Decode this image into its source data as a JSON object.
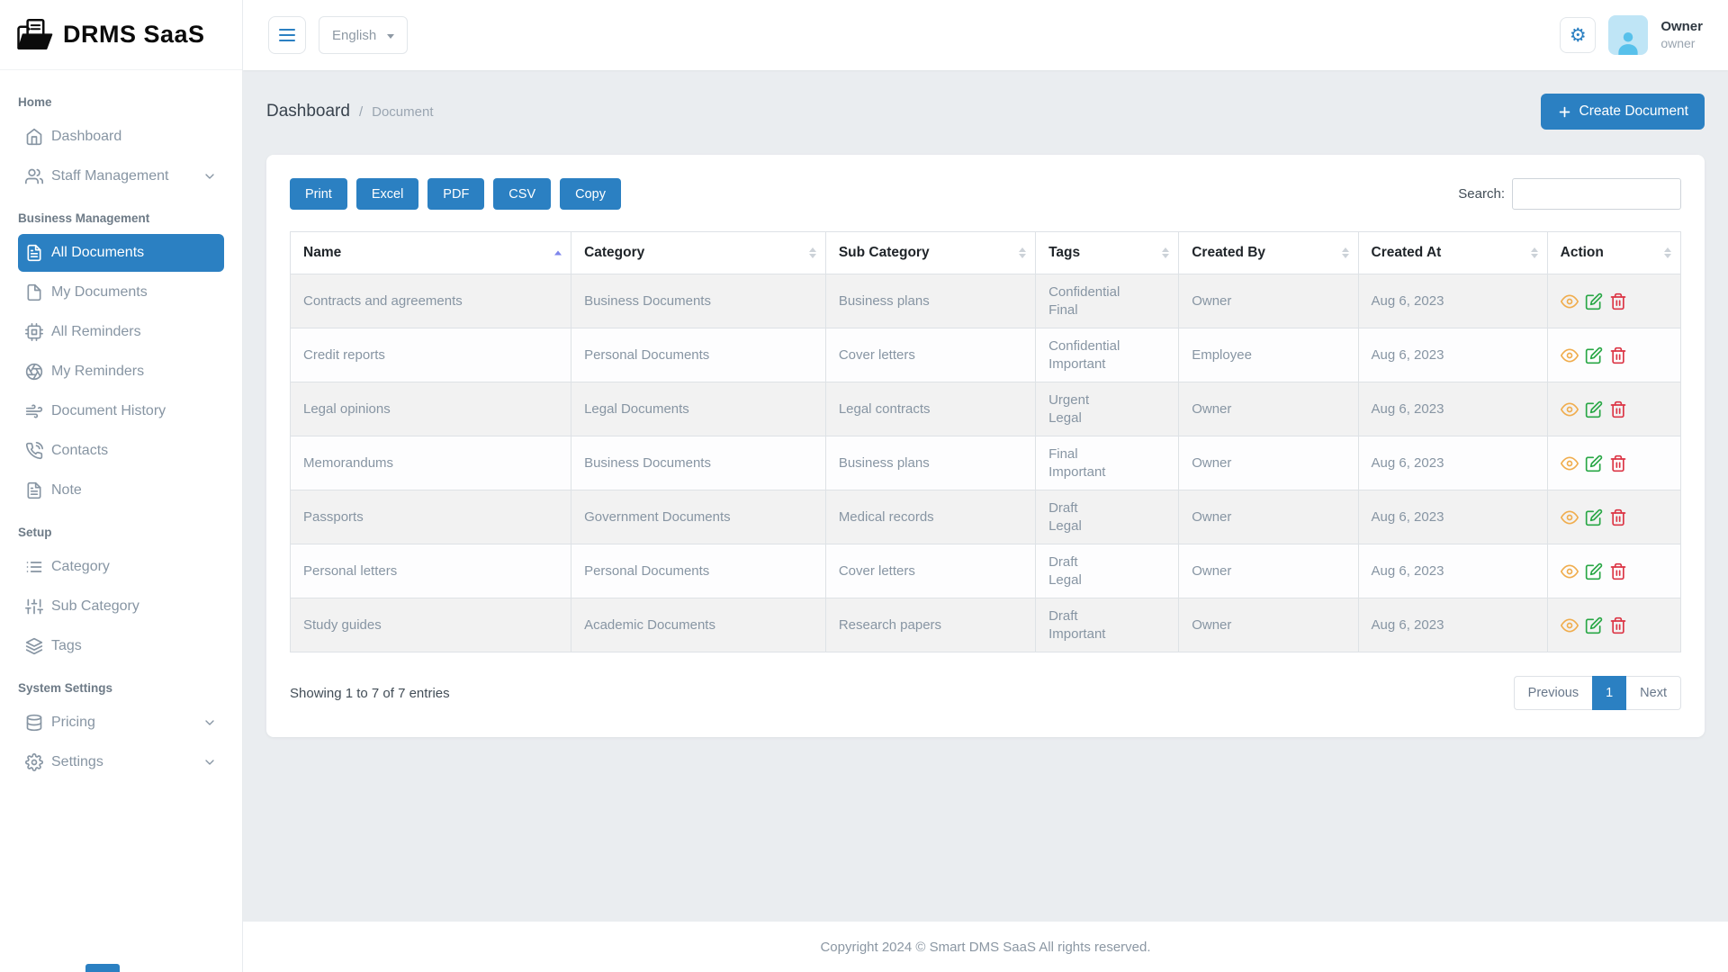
{
  "app": {
    "name": "DRMS SaaS",
    "footer": "Copyright 2024 © Smart DMS SaaS All rights reserved."
  },
  "header": {
    "language": "English",
    "user": {
      "name": "Owner",
      "role": "owner"
    }
  },
  "breadcrumb": {
    "items": [
      "Dashboard",
      "Document"
    ],
    "separator": "/"
  },
  "actions": {
    "create_label": "Create Document"
  },
  "toolbar": {
    "export_buttons": [
      "Print",
      "Excel",
      "PDF",
      "CSV",
      "Copy"
    ],
    "search_label": "Search:",
    "search_value": ""
  },
  "sidebar": {
    "sections": [
      {
        "label": "Home",
        "items": [
          {
            "label": "Dashboard",
            "icon": "home"
          },
          {
            "label": "Staff Management",
            "icon": "users",
            "expandable": true
          }
        ]
      },
      {
        "label": "Business Management",
        "items": [
          {
            "label": "All Documents",
            "icon": "file-text",
            "active": true
          },
          {
            "label": "My Documents",
            "icon": "file"
          },
          {
            "label": "All Reminders",
            "icon": "cpu"
          },
          {
            "label": "My Reminders",
            "icon": "aperture"
          },
          {
            "label": "Document History",
            "icon": "wind"
          },
          {
            "label": "Contacts",
            "icon": "phone-call"
          },
          {
            "label": "Note",
            "icon": "file-text"
          }
        ]
      },
      {
        "label": "Setup",
        "items": [
          {
            "label": "Category",
            "icon": "list"
          },
          {
            "label": "Sub Category",
            "icon": "sliders"
          },
          {
            "label": "Tags",
            "icon": "layers"
          }
        ]
      },
      {
        "label": "System Settings",
        "items": [
          {
            "label": "Pricing",
            "icon": "database",
            "expandable": true
          },
          {
            "label": "Settings",
            "icon": "settings",
            "expandable": true
          }
        ]
      }
    ]
  },
  "table": {
    "columns": [
      "Name",
      "Category",
      "Sub Category",
      "Tags",
      "Created By",
      "Created At",
      "Action"
    ],
    "sorted_column": "Name",
    "sort_direction": "asc",
    "rows": [
      {
        "name": "Contracts and agreements",
        "category": "Business Documents",
        "sub_category": "Business plans",
        "tags": [
          "Confidential",
          "Final"
        ],
        "created_by": "Owner",
        "created_at": "Aug 6, 2023"
      },
      {
        "name": "Credit reports",
        "category": "Personal Documents",
        "sub_category": "Cover letters",
        "tags": [
          "Confidential",
          "Important"
        ],
        "created_by": "Employee",
        "created_at": "Aug 6, 2023"
      },
      {
        "name": "Legal opinions",
        "category": "Legal Documents",
        "sub_category": "Legal contracts",
        "tags": [
          "Urgent",
          "Legal"
        ],
        "created_by": "Owner",
        "created_at": "Aug 6, 2023"
      },
      {
        "name": "Memorandums",
        "category": "Business Documents",
        "sub_category": "Business plans",
        "tags": [
          "Final",
          "Important"
        ],
        "created_by": "Owner",
        "created_at": "Aug 6, 2023"
      },
      {
        "name": "Passports",
        "category": "Government Documents",
        "sub_category": "Medical records",
        "tags": [
          "Draft",
          "Legal"
        ],
        "created_by": "Owner",
        "created_at": "Aug 6, 2023"
      },
      {
        "name": "Personal letters",
        "category": "Personal Documents",
        "sub_category": "Cover letters",
        "tags": [
          "Draft",
          "Legal"
        ],
        "created_by": "Owner",
        "created_at": "Aug 6, 2023"
      },
      {
        "name": "Study guides",
        "category": "Academic Documents",
        "sub_category": "Research papers",
        "tags": [
          "Draft",
          "Important"
        ],
        "created_by": "Owner",
        "created_at": "Aug 6, 2023"
      }
    ],
    "row_actions": [
      "view",
      "edit",
      "delete"
    ],
    "summary": "Showing 1 to 7 of 7 entries"
  },
  "pagination": {
    "previous": "Previous",
    "pages": [
      "1"
    ],
    "active_page": "1",
    "next": "Next"
  },
  "colors": {
    "primary": "#2b80c2",
    "view_icon": "#f0ad4e",
    "edit_icon": "#28a745",
    "delete_icon": "#dc3545",
    "row_stripe": "#f2f2f2"
  }
}
